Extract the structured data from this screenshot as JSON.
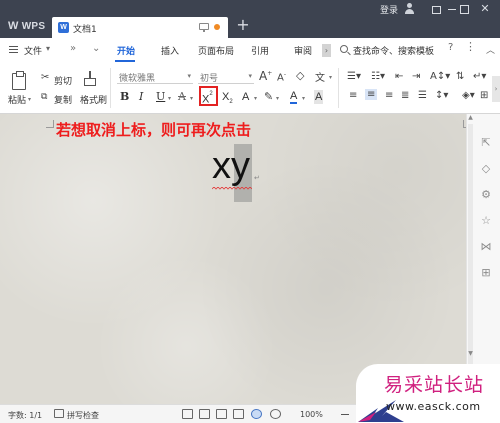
{
  "titlebar": {
    "app_name": "WPS",
    "document_tab": "文档1",
    "login_label": "登录",
    "new_tab_symbol": "+"
  },
  "menu": {
    "file_label": "文件",
    "tabs": [
      {
        "label": "开始",
        "active": true
      },
      {
        "label": "插入",
        "active": false
      },
      {
        "label": "页面布局",
        "active": false
      },
      {
        "label": "引用",
        "active": false
      },
      {
        "label": "审阅",
        "active": false
      }
    ],
    "search_label": "查找命令、搜索模板",
    "help_symbol": "?",
    "more_symbol": "⋮"
  },
  "ribbon": {
    "paste_label": "粘贴",
    "cut_label": "剪切",
    "copy_label": "复制",
    "format_painter_label": "格式刷",
    "font_name": "微软雅黑",
    "font_size": "初号",
    "font_buttons": {
      "bold": "B",
      "italic": "I",
      "underline": "U",
      "strikethrough": "A",
      "superscript_main": "X",
      "superscript_mark": "2",
      "subscript_main": "X",
      "subscript_mark": "2",
      "text_effect": "A",
      "font_color": "A",
      "char_shading": "A"
    },
    "grow_font": "A",
    "shrink_font": "A"
  },
  "document": {
    "instruction": "若想取消上标，则可再次点击",
    "body_text": "xy",
    "para_mark": "↵"
  },
  "statusbar": {
    "word_count": "字数: 1/1",
    "spell_check": "拼写检查",
    "zoom": "100%"
  },
  "watermark": {
    "title": "易采站长站",
    "url": "www.easck.com"
  },
  "colors": {
    "titlebar_bg": "#3d4350",
    "accent": "#2166d9",
    "highlight_red": "#e32222",
    "doc_background": "#dddbd4"
  }
}
